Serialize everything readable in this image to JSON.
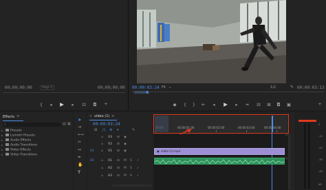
{
  "source_monitor": {
    "timecode_left": "00;00;00;00",
    "page_label": "Page 1",
    "timecode_right": "00;00;00;00"
  },
  "program_monitor": {
    "timecode_current": "00:00:03:24",
    "fit_label": "Fit",
    "fraction_label": "1/2",
    "timecode_duration": "00:00:03:13"
  },
  "effects": {
    "title": "Effects",
    "search_placeholder": "",
    "items": [
      {
        "label": "Presets"
      },
      {
        "label": "Lumetri Presets"
      },
      {
        "label": "Audio Effects"
      },
      {
        "label": "Audio Transitions"
      },
      {
        "label": "Video Effects"
      },
      {
        "label": "Video Transitions"
      }
    ]
  },
  "timeline": {
    "sequence_tab": "video (1)",
    "timecode": "00:00:03:24",
    "ruler_labels": [
      "00:00",
      "00:00:01:00",
      "00:00:02:00",
      "00:00:03:00",
      "00:00:04:00"
    ],
    "video_tracks": [
      "V3",
      "V2",
      "V1"
    ],
    "audio_tracks": [
      "A1",
      "A2",
      "A3"
    ],
    "clip_label": "video (1).mp4",
    "highlight_color": "#e03a1e"
  },
  "meters": {
    "scale": [
      "0",
      "-12",
      "-24",
      "-36",
      "-48",
      "dB"
    ]
  }
}
